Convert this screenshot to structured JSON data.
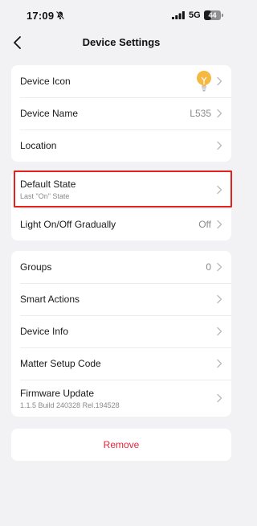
{
  "status": {
    "time": "17:09",
    "network": "5G",
    "battery": "44",
    "battery_level_percent": 44
  },
  "nav": {
    "title": "Device Settings"
  },
  "group1": {
    "device_icon_label": "Device Icon",
    "device_name_label": "Device Name",
    "device_name_value": "L535",
    "location_label": "Location"
  },
  "group2": {
    "default_state_label": "Default State",
    "default_state_sub": "Last \"On\" State",
    "light_gradual_label": "Light On/Off Gradually",
    "light_gradual_value": "Off"
  },
  "group3": {
    "groups_label": "Groups",
    "groups_value": "0",
    "smart_actions_label": "Smart Actions",
    "device_info_label": "Device Info",
    "matter_label": "Matter Setup Code",
    "firmware_label": "Firmware Update",
    "firmware_sub": "1.1.5 Build 240328 Rel.194528"
  },
  "remove_label": "Remove",
  "colors": {
    "accent_red": "#e5243b",
    "highlight_border": "#e2231a",
    "bulb": "#f5b942"
  },
  "icons": [
    "bell-off-icon",
    "signal-icon",
    "back-arrow-icon",
    "bulb-icon",
    "chevron-right-icon"
  ]
}
